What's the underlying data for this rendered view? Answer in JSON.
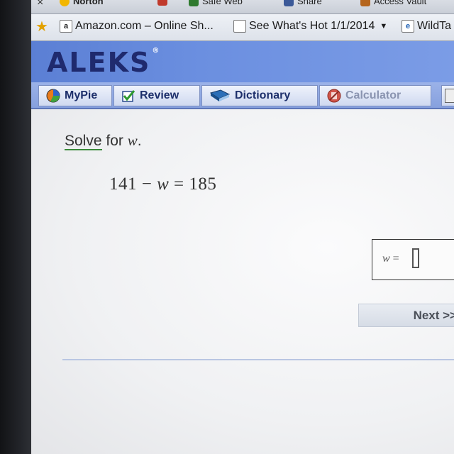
{
  "browser": {
    "toolbar_items": [
      {
        "icon": "norton-icon",
        "label": "Norton"
      },
      {
        "icon": "home-icon",
        "label": ""
      },
      {
        "icon": "safe-web-icon",
        "label": "Safe Web"
      },
      {
        "icon": "facebook-icon",
        "label": "Share"
      },
      {
        "icon": "vault-icon",
        "label": "Access Vault"
      }
    ],
    "favorites": [
      {
        "icon": "amazon-icon",
        "label": "Amazon.com – Online Sh...",
        "badge": "a"
      },
      {
        "icon": "page-icon",
        "label": "See What's Hot 1/1/2014"
      },
      {
        "icon": "ie-icon",
        "label": "WildTa"
      }
    ]
  },
  "app": {
    "logo": "ALEKS",
    "logo_mark": "®"
  },
  "tabs": [
    {
      "label": "MyPie",
      "icon": "pie-chart-icon"
    },
    {
      "label": "Review",
      "icon": "checkmark-icon"
    },
    {
      "label": "Dictionary",
      "icon": "book-icon"
    },
    {
      "label": "Calculator",
      "icon": "calculator-icon"
    }
  ],
  "problem": {
    "instruction_link": "Solve",
    "instruction_rest": "for",
    "variable": "w",
    "period": ".",
    "equation_left": "141 − ",
    "equation_var": "w",
    "equation_right": " = 185"
  },
  "answer": {
    "label_var": "w",
    "label_eq": " =",
    "value": ""
  },
  "next_label": "Next >>",
  "colors": {
    "header_blue": "#6b8fe0",
    "logo_navy": "#1f2a6e",
    "tab_text": "#1d2f6b",
    "solve_underline": "#3a8a3a"
  }
}
